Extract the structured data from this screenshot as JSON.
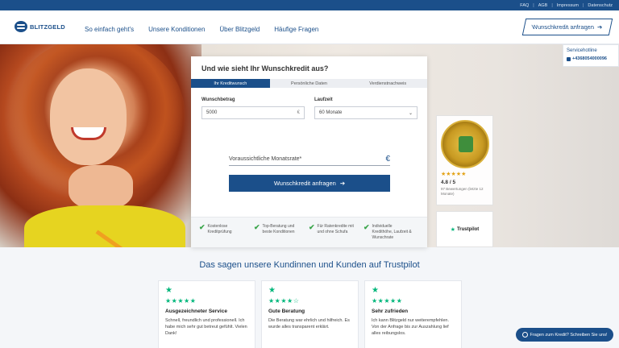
{
  "topbar": {
    "links": [
      "FAQ",
      "AGB",
      "Impressum",
      "Datenschutz"
    ]
  },
  "header": {
    "logo_text": "BLITZGELD",
    "nav": [
      "So einfach geht's",
      "Unsere Konditionen",
      "Über Blitzgeld",
      "Häufige Fragen"
    ],
    "cta_label": "Wunschkredit anfragen"
  },
  "hotline": {
    "title": "Servicehotline",
    "phone": "+4368054000096"
  },
  "form": {
    "title": "Und wie sieht Ihr Wunschkredit aus?",
    "steps": [
      "Ihr Kreditwunsch",
      "Persönliche Daten",
      "Verdienstnachweis"
    ],
    "amount_label": "Wunschbetrag",
    "amount_value": "5000",
    "amount_unit": "€",
    "duration_label": "Laufzeit",
    "duration_value": "60 Monate",
    "rate_label": "Voraussichtliche Monatsrate*",
    "rate_unit": "€",
    "submit_label": "Wunschkredit anfragen",
    "features": [
      "Kostenlose Kreditprüfung",
      "Top-Beratung und beste Konditionen",
      "Für Ratenkredite mit und ohne Schufa",
      "Individuelle Kredithöhe, Laufzeit & Wunschrate"
    ]
  },
  "ekomi": {
    "stars": "★★★★★",
    "score": "4.8 / 5",
    "count": "97 Bewertungen (letzte 12 Monate)"
  },
  "trustpilot": {
    "label": "Trustpilot"
  },
  "reviews": {
    "title": "Das sagen unsere Kundinnen und Kunden auf Trustpilot",
    "items": [
      {
        "stars": "★★★★★",
        "title": "Ausgezeichneter Service",
        "text": "Schnell, freundlich und professionell. Ich habe mich sehr gut betreut gefühlt. Vielen Dank!"
      },
      {
        "stars": "★★★★☆",
        "title": "Gute Beratung",
        "text": "Die Beratung war ehrlich und hilfreich. Es wurde alles transparent erklärt."
      },
      {
        "stars": "★★★★★",
        "title": "Sehr zufrieden",
        "text": "Ich kann Blitzgeld nur weiterempfehlen. Von der Anfrage bis zur Auszahlung lief alles reibungslos."
      }
    ]
  },
  "chat": {
    "label": "Fragen zum Kredit? Schreiben Sie uns!"
  },
  "colors": {
    "brand": "#1b4f8a",
    "check": "#3aa54a",
    "trustpilot": "#00b67a"
  }
}
